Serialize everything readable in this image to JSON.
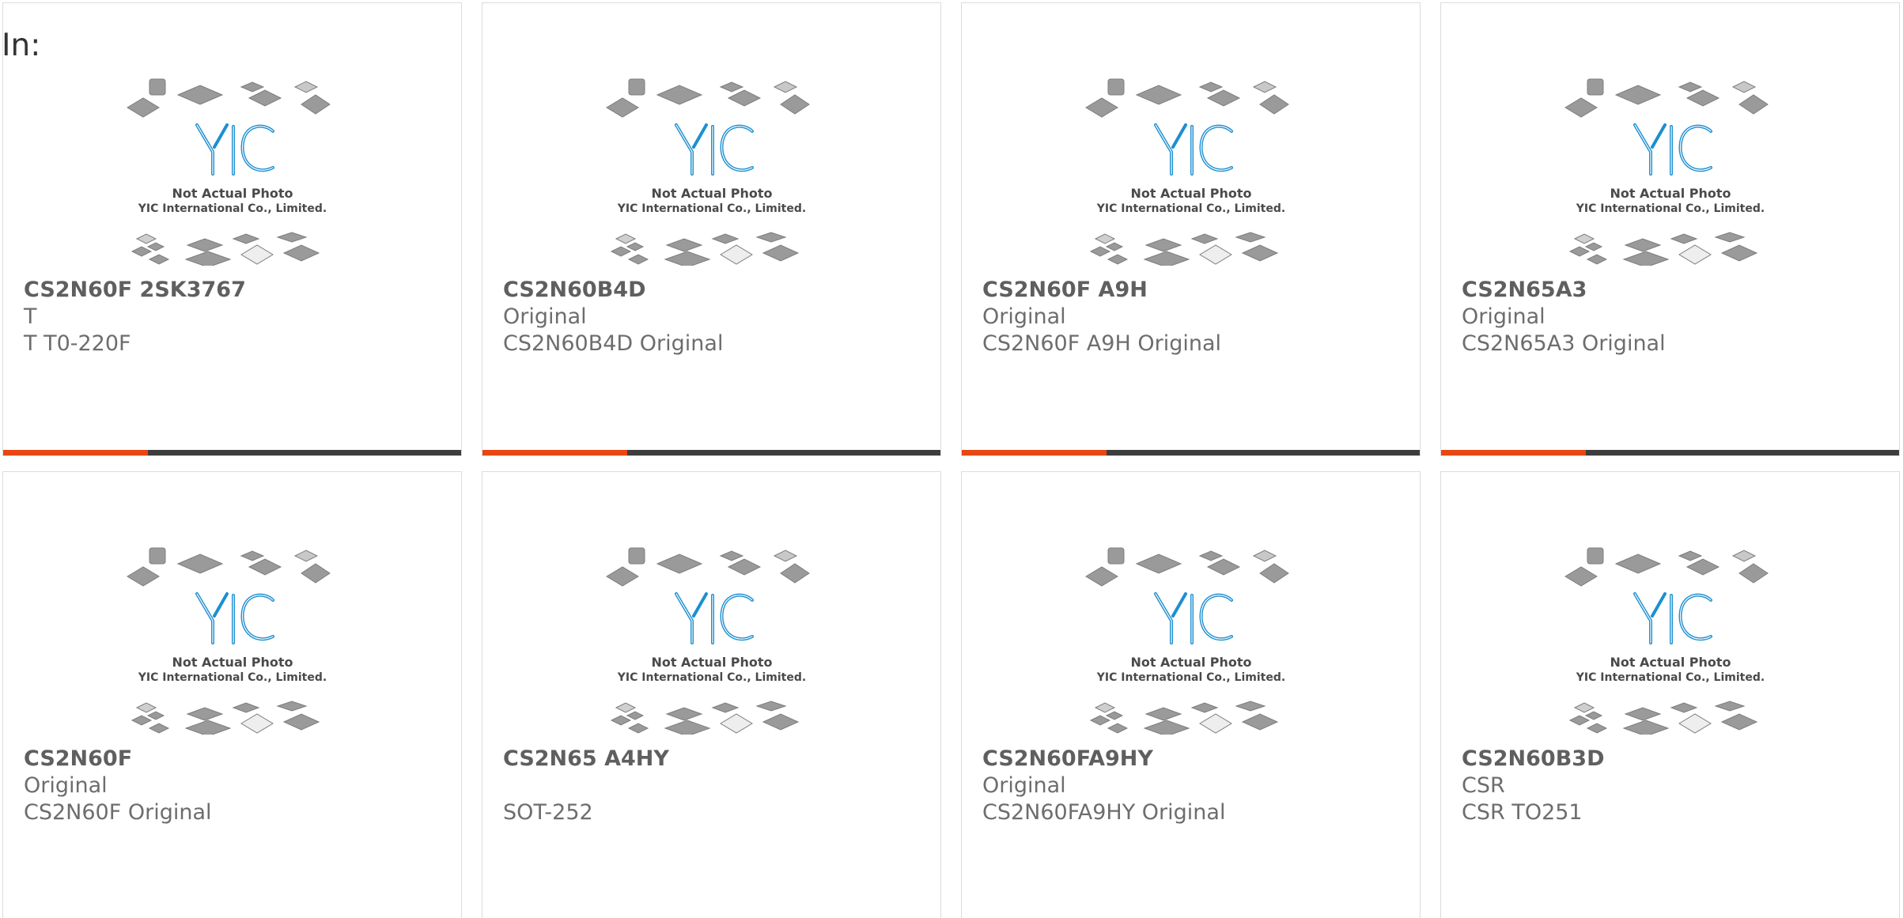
{
  "page": {
    "in_label": "In:"
  },
  "photo": {
    "line1": "Not Actual Photo",
    "line2": "YIC International Co., Limited.",
    "logo": "YIC",
    "colors": {
      "chip_gray": "#9a9a9a",
      "logo_blue": "#1d8fd1",
      "caption": "#4a4a4a"
    }
  },
  "colors": {
    "accent_bar": "#e84614",
    "dark_bar": "#3d3d3d",
    "text": "#6d6d6d"
  },
  "products": [
    {
      "title": "CS2N60F 2SK3767",
      "line1": "T",
      "line2": "T T0-220F"
    },
    {
      "title": "CS2N60B4D",
      "line1": "Original",
      "line2": "CS2N60B4D Original"
    },
    {
      "title": "CS2N60F A9H",
      "line1": "Original",
      "line2": "CS2N60F A9H Original"
    },
    {
      "title": "CS2N65A3",
      "line1": "Original",
      "line2": "CS2N65A3 Original"
    },
    {
      "title": "CS2N60F",
      "line1": "Original",
      "line2": "CS2N60F Original"
    },
    {
      "title": "CS2N65 A4HY",
      "line1": "",
      "line2": "SOT-252"
    },
    {
      "title": "CS2N60FA9HY",
      "line1": "Original",
      "line2": "CS2N60FA9HY Original"
    },
    {
      "title": "CS2N60B3D",
      "line1": "CSR",
      "line2": "CSR TO251"
    }
  ]
}
